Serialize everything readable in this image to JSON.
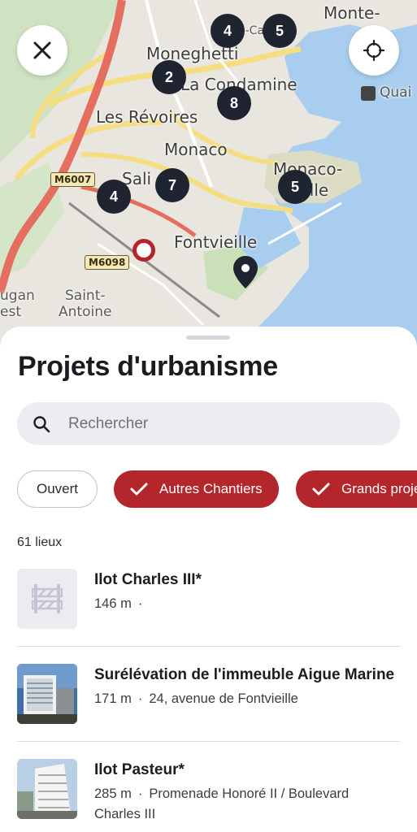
{
  "map": {
    "labels": {
      "monte_carlo": "Monte-",
      "moneghetti": "Moneghetti",
      "monte_carlo_small": "Monte-Car",
      "la_condamine": "La Condamine",
      "quai": "Quai",
      "les_revoires": "Les Révoires",
      "monaco": "Monaco",
      "sali": "Sali",
      "monaco_ville_1": "Monaco-",
      "monaco_ville_2": "Ville",
      "fontvieille": "Fontvieille",
      "saint": "Saint-",
      "antoine": "Antoine",
      "ugan": "ugan",
      "est": "est"
    },
    "road_badges": [
      "M6007",
      "M6098"
    ],
    "clusters": [
      {
        "label": "4"
      },
      {
        "label": "5"
      },
      {
        "label": "2"
      },
      {
        "label": "8"
      },
      {
        "label": "7"
      },
      {
        "label": "4"
      },
      {
        "label": "5"
      }
    ],
    "close_button_icon": "close-icon",
    "locate_button_icon": "crosshair-icon"
  },
  "sheet": {
    "title": "Projets d'urbanisme",
    "search": {
      "placeholder": "Rechercher",
      "value": ""
    },
    "filters": [
      {
        "label": "Ouvert",
        "selected": false
      },
      {
        "label": "Autres Chantiers",
        "selected": true
      },
      {
        "label": "Grands projets",
        "selected": true
      }
    ],
    "count": "61 lieux",
    "items": [
      {
        "title": "Ilot Charles III*",
        "distance": "146 m",
        "separator": "·",
        "address": "",
        "address_line2": "",
        "thumb": "barrier-icon"
      },
      {
        "title": "Surélévation de l'immeuble Aigue Marine",
        "distance": "171 m",
        "separator": "·",
        "address": "24, avenue de Fontvieille",
        "address_line2": "",
        "thumb": "photo-building"
      },
      {
        "title": "Ilot Pasteur*",
        "distance": "285 m",
        "separator": "·",
        "address": "Promenade Honoré II / Boulevard",
        "address_line2": "Charles III",
        "thumb": "photo-building"
      }
    ]
  },
  "colors": {
    "accent": "#b3262b",
    "map_water": "#a9cdee",
    "cluster": "#1f2530"
  }
}
